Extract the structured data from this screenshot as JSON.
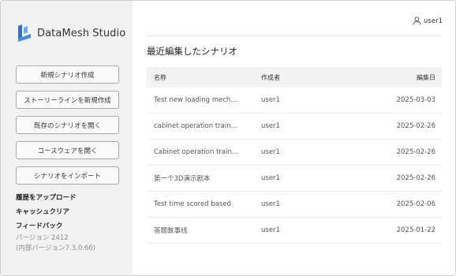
{
  "app": {
    "title": "DataMesh Studio",
    "accent_color": "#2f6fc6"
  },
  "sidebar": {
    "buttons": [
      "新規シナリオ作成",
      "ストーリーラインを新規作成",
      "既存のシナリオを開く",
      "コースウェアを開く",
      "シナリオをインポート"
    ],
    "links": [
      "履歴をアップロード",
      "キャッシュクリア",
      "フィードバック"
    ],
    "version": "バージョン 2412",
    "internal_version": "(内部バージョン7.3.0.66)"
  },
  "header": {
    "user_icon": "user-icon",
    "username": "user1"
  },
  "recent": {
    "title": "最近編集したシナリオ",
    "columns": [
      "名称",
      "作成者",
      "編集日"
    ],
    "rows": [
      [
        "Test new loading mech…",
        "user1",
        "2025-03-03"
      ],
      [
        "cabinet operation train…",
        "user1",
        "2025-02-26"
      ],
      [
        "Cabinet operation train…",
        "user1",
        "2025-02-26"
      ],
      [
        "第一个3D演示剧本",
        "user1",
        "2025-02-26"
      ],
      [
        "Test time scored based",
        "user1",
        "2025-02-06"
      ],
      [
        "答题故事线",
        "user1",
        "2025-01-22"
      ]
    ]
  }
}
